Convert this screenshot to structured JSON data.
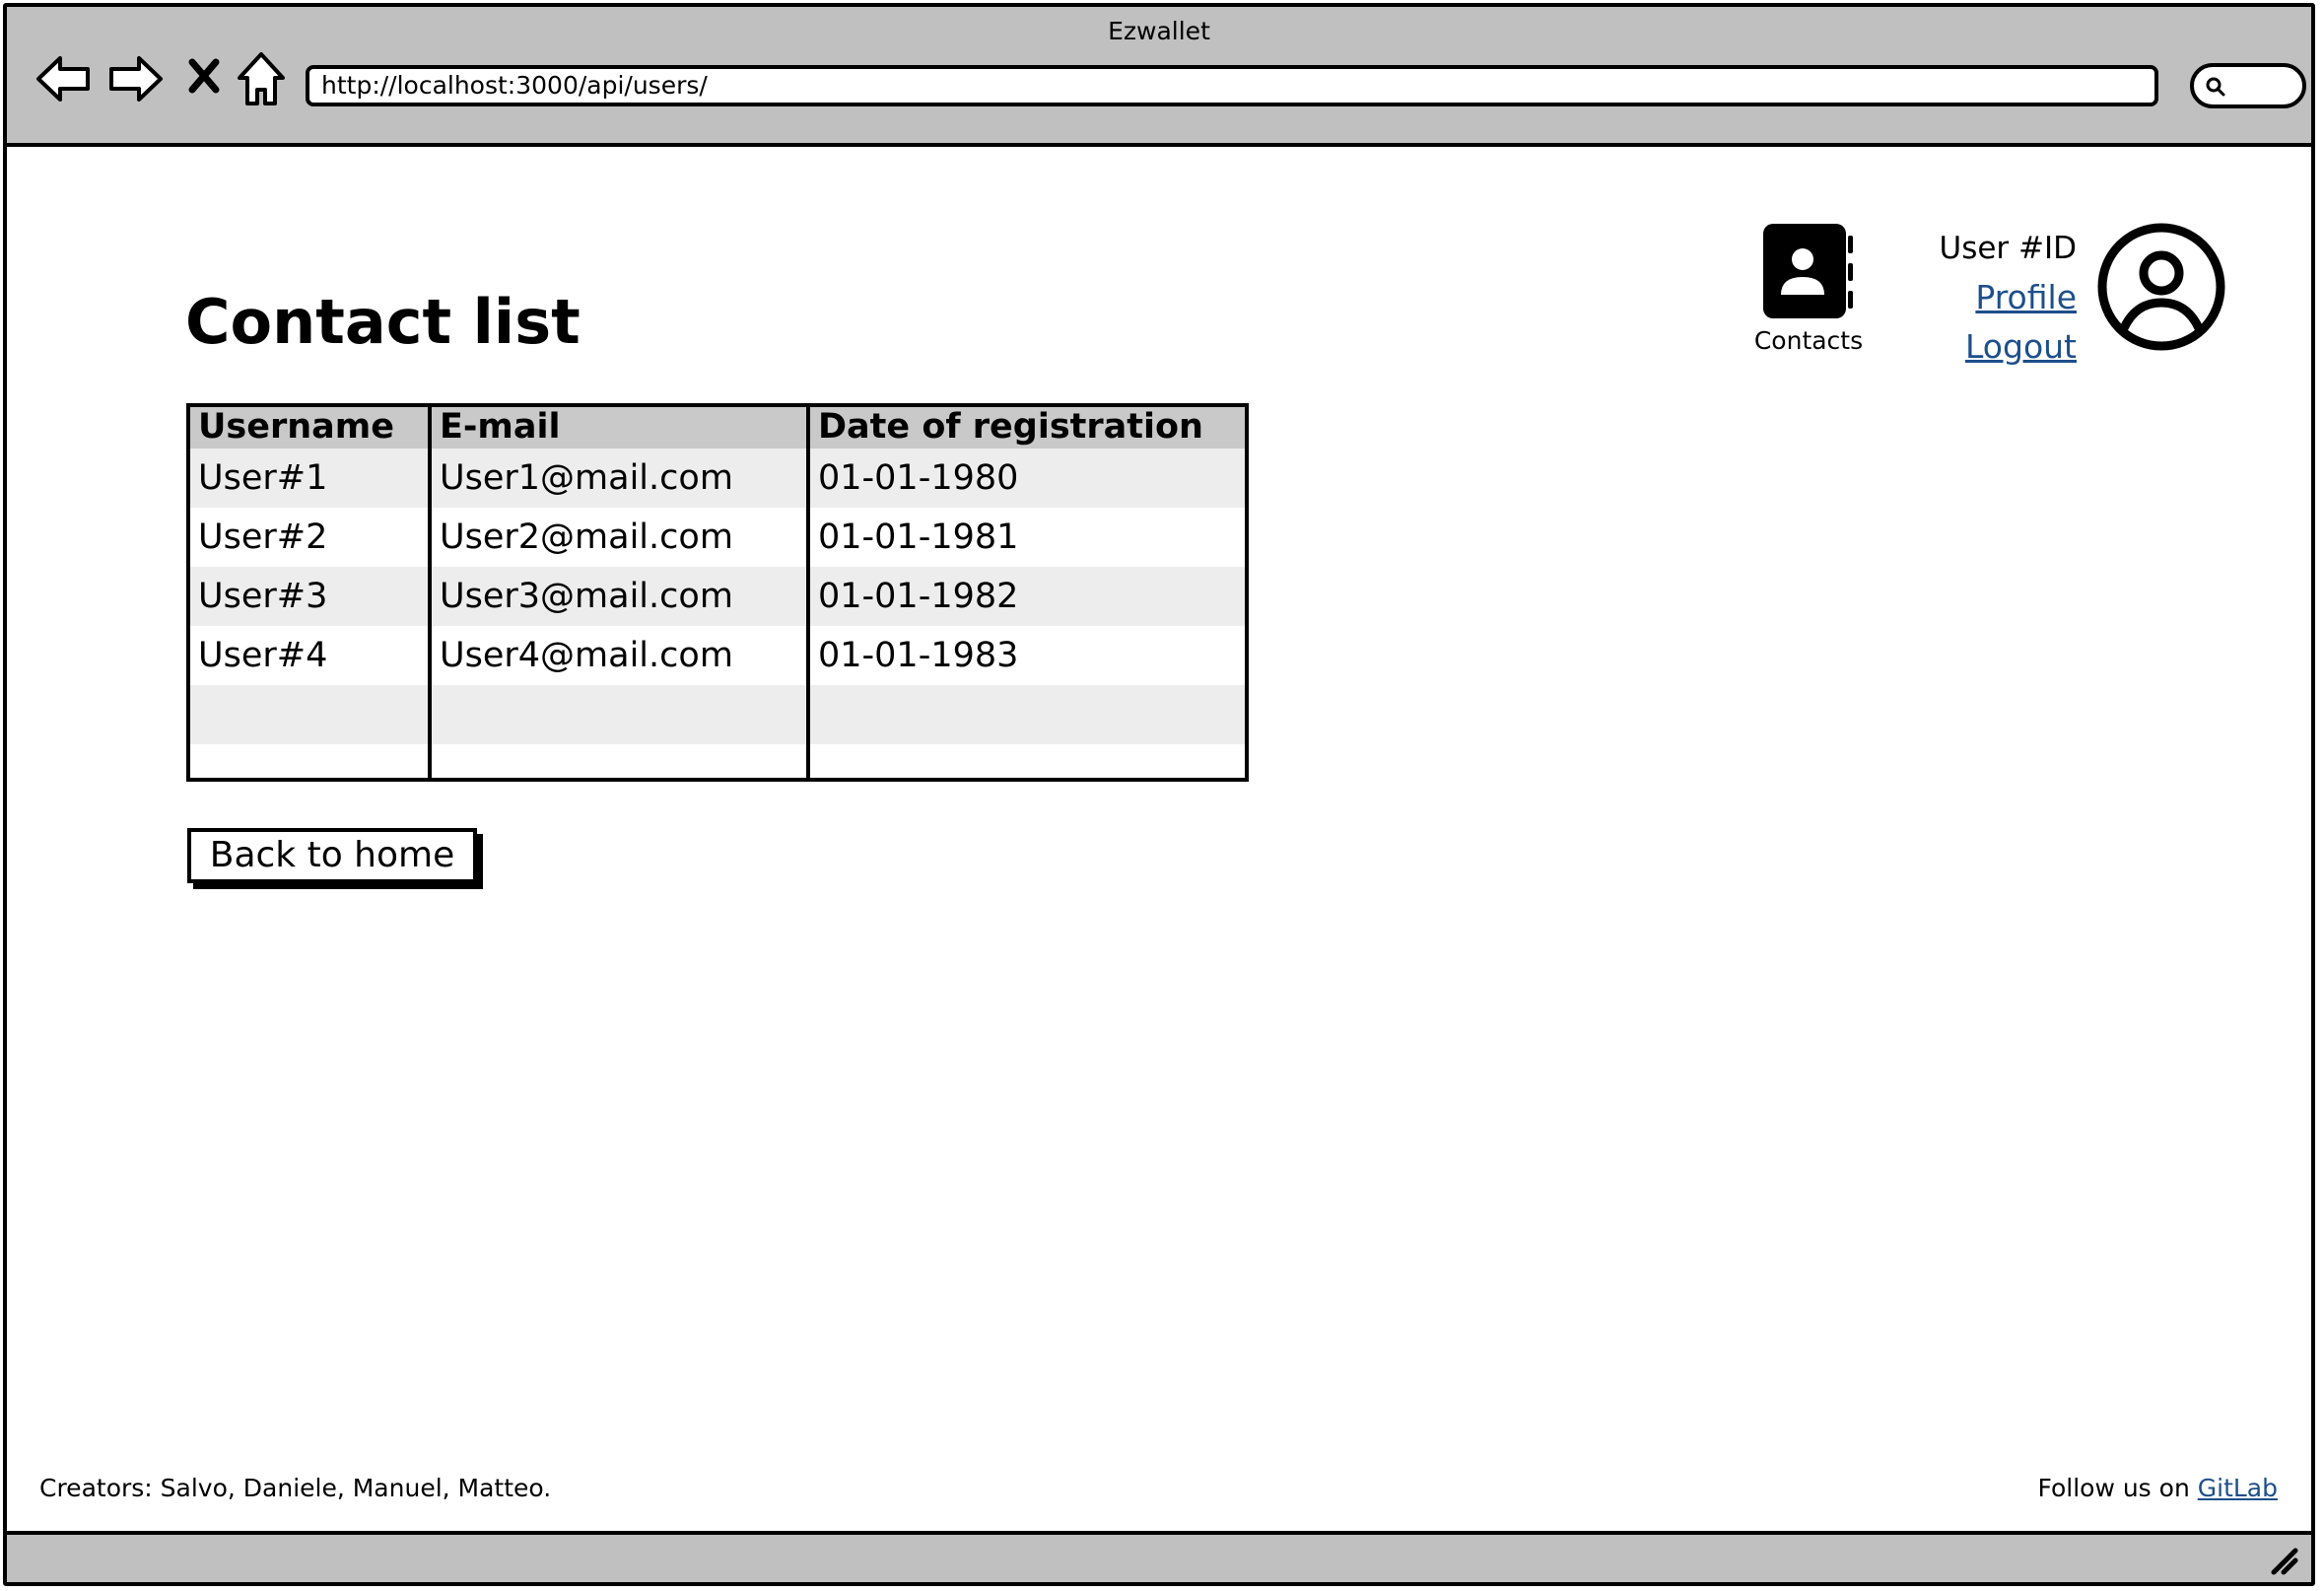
{
  "window": {
    "title": "Ezwallet"
  },
  "browser": {
    "url": "http://localhost:3000/api/users/",
    "icons": [
      "back-arrow-icon",
      "forward-arrow-icon",
      "stop-icon",
      "home-icon",
      "search-icon"
    ]
  },
  "header": {
    "contacts_label": "Contacts",
    "user_id": "User #ID",
    "profile_link": "Profile",
    "logout_link": "Logout"
  },
  "main": {
    "title": "Contact list",
    "table": {
      "columns": [
        "Username",
        "E-mail",
        "Date of registration"
      ],
      "rows": [
        [
          "User#1",
          "User1@mail.com",
          "01-01-1980"
        ],
        [
          "User#2",
          "User2@mail.com",
          "01-01-1981"
        ],
        [
          "User#3",
          "User3@mail.com",
          "01-01-1982"
        ],
        [
          "User#4",
          "User4@mail.com",
          "01-01-1983"
        ],
        [
          "",
          "",
          ""
        ],
        [
          "",
          "",
          ""
        ]
      ]
    },
    "back_button": "Back to home"
  },
  "footer": {
    "creators": "Creators: Salvo, Daniele, Manuel, Matteo.",
    "follow_text": "Follow us on ",
    "gitlab_link": "GitLab"
  }
}
